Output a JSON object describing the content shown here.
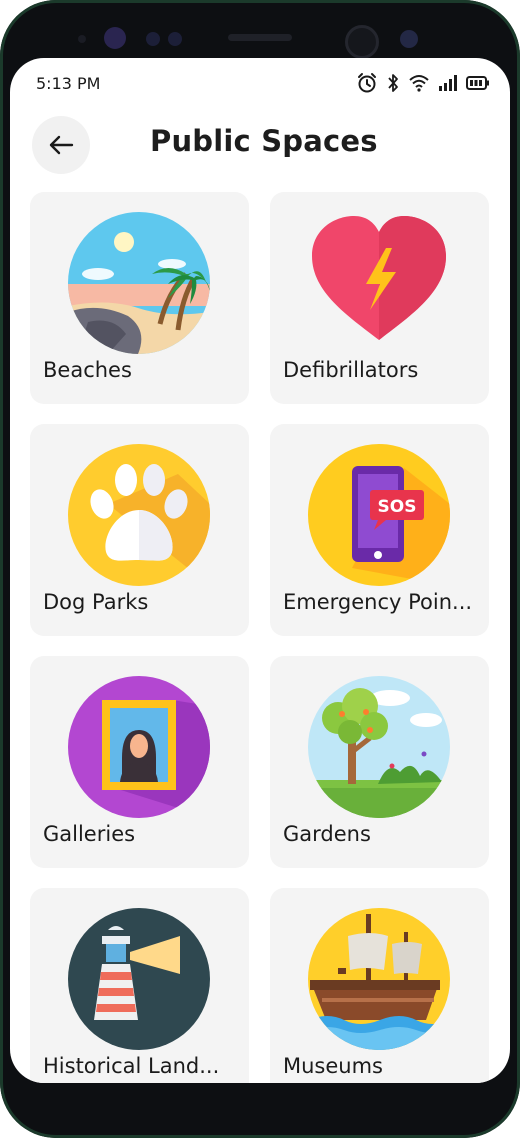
{
  "status_bar": {
    "time": "5:13 PM"
  },
  "header": {
    "title": "Public Spaces",
    "back_icon": "arrow-left-icon"
  },
  "categories": [
    {
      "label": "Beaches",
      "icon": "beach-icon"
    },
    {
      "label": "Defibrillators",
      "icon": "heart-bolt-icon"
    },
    {
      "label": "Dog Parks",
      "icon": "paw-icon"
    },
    {
      "label": "Emergency Poin...",
      "icon": "sos-phone-icon"
    },
    {
      "label": "Galleries",
      "icon": "portrait-frame-icon"
    },
    {
      "label": "Gardens",
      "icon": "garden-tree-icon"
    },
    {
      "label": "Historical Land...",
      "icon": "lighthouse-icon"
    },
    {
      "label": "Museums",
      "icon": "ship-icon"
    }
  ]
}
